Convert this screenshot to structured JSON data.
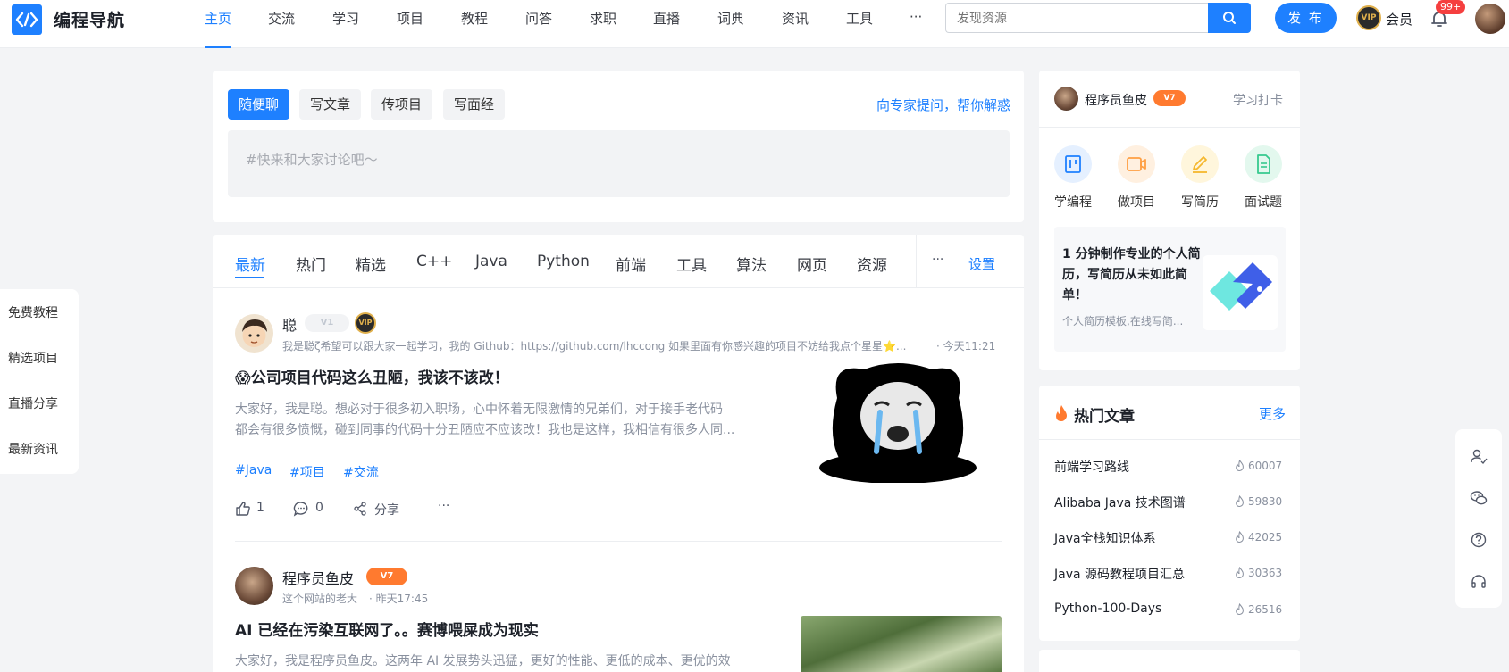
{
  "header": {
    "logo_text": "编程导航",
    "nav": [
      "主页",
      "交流",
      "学习",
      "项目",
      "教程",
      "问答",
      "求职",
      "直播",
      "词典",
      "资讯",
      "工具",
      "···"
    ],
    "search_placeholder": "发现资源",
    "publish_label": "发 布",
    "vip_badge": "VIP",
    "vip_label": "会员",
    "notification_count": "99+"
  },
  "composer": {
    "categories": [
      "随便聊",
      "写文章",
      "传项目",
      "写面经"
    ],
    "ask_link": "向专家提问，帮你解惑",
    "placeholder": "#快来和大家讨论吧～"
  },
  "feed_tabs": {
    "items": [
      "最新",
      "热门",
      "精选",
      "C++",
      "Java",
      "Python",
      "前端",
      "工具",
      "算法",
      "网页",
      "资源"
    ],
    "more": "···",
    "settings": "设置"
  },
  "posts": [
    {
      "author": "聪",
      "level": "V1",
      "vip": "VIP",
      "bio": "我是聪ζ希望可以跟大家一起学习，我的 Github：https://github.com/lhccong 如果里面有你感兴趣的项目不妨给我点个星星⭐...",
      "time": "· 今天11:21",
      "title": "😱公司项目代码这么丑陋，我该不该改！",
      "excerpt_line1": "大家好，我是聪。想必对于很多初入职场，心中怀着无限激情的兄弟们，对于接手老代码",
      "excerpt_line2": "都会有很多愤慨，碰到同事的代码十分丑陋应不应该改！我也是这样，我相信有很多人同...",
      "tags": [
        "#Java",
        "#项目",
        "#交流"
      ],
      "likes": "1",
      "comments": "0",
      "share_label": "分享",
      "more": "···"
    },
    {
      "author": "程序员鱼皮",
      "level": "V7",
      "bio": "这个网站的老大",
      "time": "· 昨天17:45",
      "title": "AI 已经在污染互联网了。。赛博喂屎成为现实",
      "excerpt_line1": "大家好，我是程序员鱼皮。这两年 AI 发展势头迅猛，更好的性能、更低的成本、更优的效"
    }
  ],
  "left_sidebar": [
    "免费教程",
    "精选项目",
    "直播分享",
    "最新资讯"
  ],
  "user_card": {
    "name": "程序员鱼皮",
    "level": "V7",
    "checkin": "学习打卡",
    "quick_links": [
      {
        "label": "学编程",
        "icon": "kanban-icon",
        "color": "#1e80ff",
        "bg": "#e5f0ff"
      },
      {
        "label": "做项目",
        "icon": "video-icon",
        "color": "#ff9f43",
        "bg": "#fff0e0"
      },
      {
        "label": "写简历",
        "icon": "pen-icon",
        "color": "#f5b82e",
        "bg": "#fff6dc"
      },
      {
        "label": "面试题",
        "icon": "document-icon",
        "color": "#36c98e",
        "bg": "#e3f8ee"
      }
    ],
    "promo_title": "1 分钟制作专业的个人简历，写简历从未如此简单！",
    "promo_sub": "个人简历模板,在线写简..."
  },
  "hot_articles": {
    "title": "热门文章",
    "more": "更多",
    "items": [
      {
        "title": "前端学习路线",
        "count": "60007"
      },
      {
        "title": "Alibaba Java 技术图谱",
        "count": "59830"
      },
      {
        "title": "Java全栈知识体系",
        "count": "42025"
      },
      {
        "title": "Java 源码教程项目汇总",
        "count": "30363"
      },
      {
        "title": "Python-100-Days",
        "count": "26516"
      }
    ]
  },
  "float_bar": [
    "contact-icon",
    "wechat-icon",
    "help-icon",
    "headset-icon"
  ]
}
